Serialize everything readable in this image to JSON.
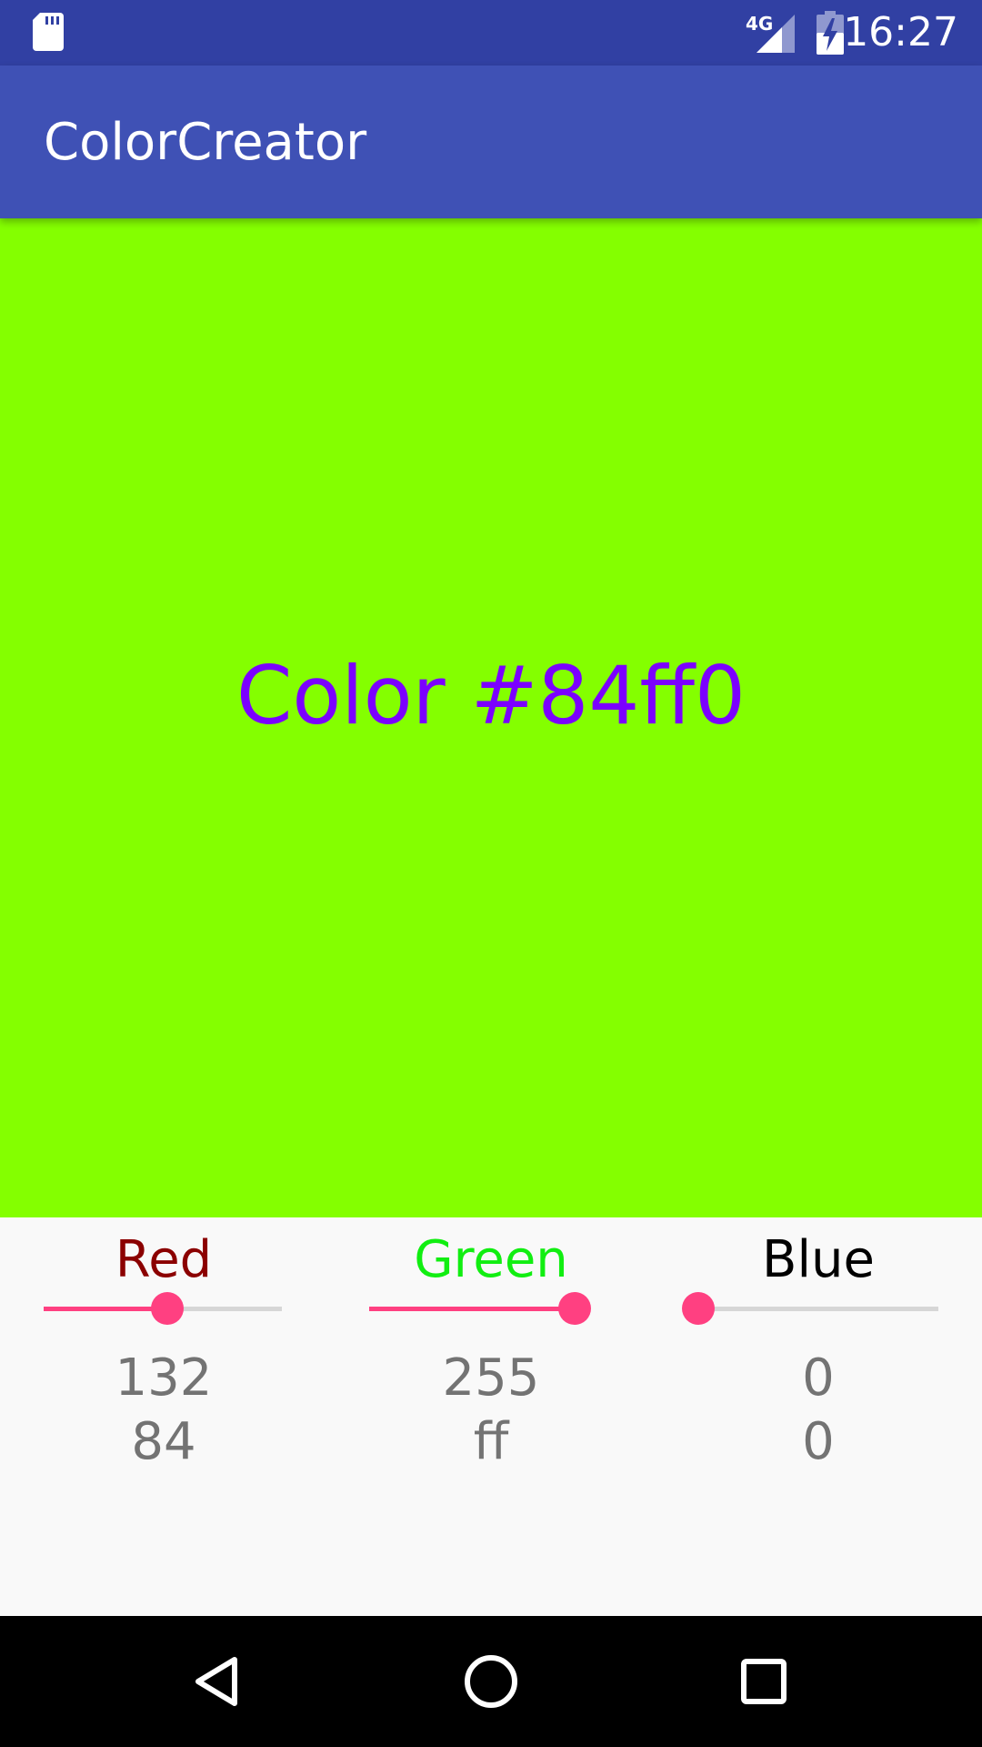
{
  "status_bar": {
    "time": "16:27",
    "network": "4G",
    "icons": [
      "sd-card-icon",
      "cellular-signal-icon",
      "battery-charging-icon"
    ]
  },
  "app_bar": {
    "title": "ColorCreator",
    "color": "#3f51b5"
  },
  "preview": {
    "label": "Color #84ff0",
    "background": "#84ff00",
    "text_color": "#7b00ff"
  },
  "channels": [
    {
      "name": "Red",
      "name_color": "#8b0000",
      "decimal": "132",
      "hex": "84",
      "level": 0.518
    },
    {
      "name": "Green",
      "name_color": "#11ee11",
      "decimal": "255",
      "hex": "ff",
      "level": 1.0
    },
    {
      "name": "Blue",
      "name_color": "#000000",
      "decimal": "0",
      "hex": "0",
      "level": 0.0
    }
  ],
  "slider_accent": "#ff4081",
  "nav_bar": {
    "icons": [
      "back-icon",
      "home-icon",
      "recents-icon"
    ]
  }
}
